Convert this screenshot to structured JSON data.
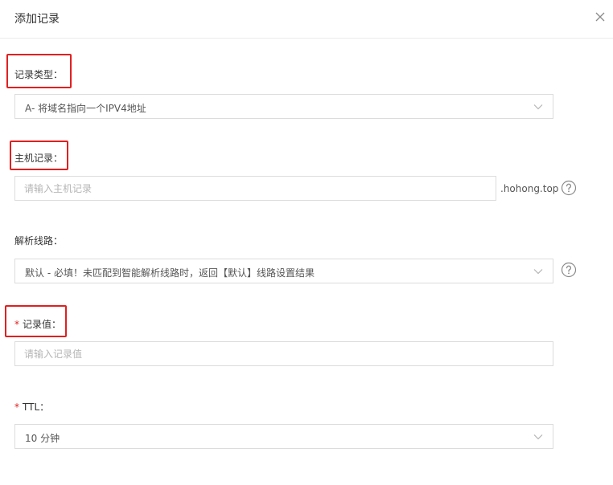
{
  "dialog": {
    "title": "添加记录"
  },
  "record_type": {
    "label": "记录类型：",
    "value": "A- 将域名指向一个IPV4地址"
  },
  "host_record": {
    "label": "主机记录：",
    "placeholder": "请输入主机记录",
    "suffix": ".hohong.top"
  },
  "resolve_line": {
    "label": "解析线路：",
    "value": "默认 - 必填！未匹配到智能解析线路时，返回【默认】线路设置结果"
  },
  "record_value": {
    "required_mark": "*",
    "label": "记录值：",
    "placeholder": "请输入记录值"
  },
  "ttl": {
    "required_mark": "*",
    "label": "TTL：",
    "value": "10 分钟"
  },
  "colors": {
    "highlight": "#e02020",
    "border": "#dcdcdc",
    "placeholder": "#b5b5b5"
  },
  "icons": {
    "close": "close-icon",
    "dropdown": "chevron-down-icon",
    "help": "question-circle-icon"
  }
}
